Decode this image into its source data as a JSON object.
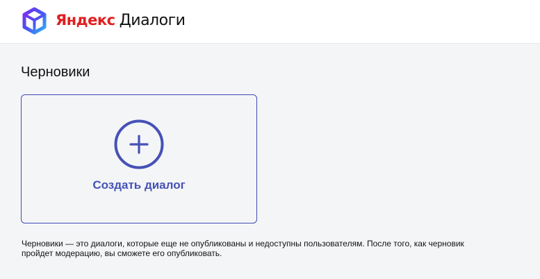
{
  "header": {
    "brand": "Яндекс",
    "product": "Диалоги",
    "logo_icon": "yandex-dialogs-cube-icon"
  },
  "main": {
    "title": "Черновики",
    "create_card": {
      "label": "Создать диалог",
      "icon": "plus-circle-icon"
    },
    "description": "Черновики — это диалоги, которые еще не опубликованы и недоступны пользователям. После того, как черновик пройдет модерацию, вы сможете его опубликовать."
  },
  "colors": {
    "accent": "#4552b6",
    "brand_red": "#e01e1e",
    "background": "#f4f5f7",
    "header_bg": "#ffffff"
  }
}
